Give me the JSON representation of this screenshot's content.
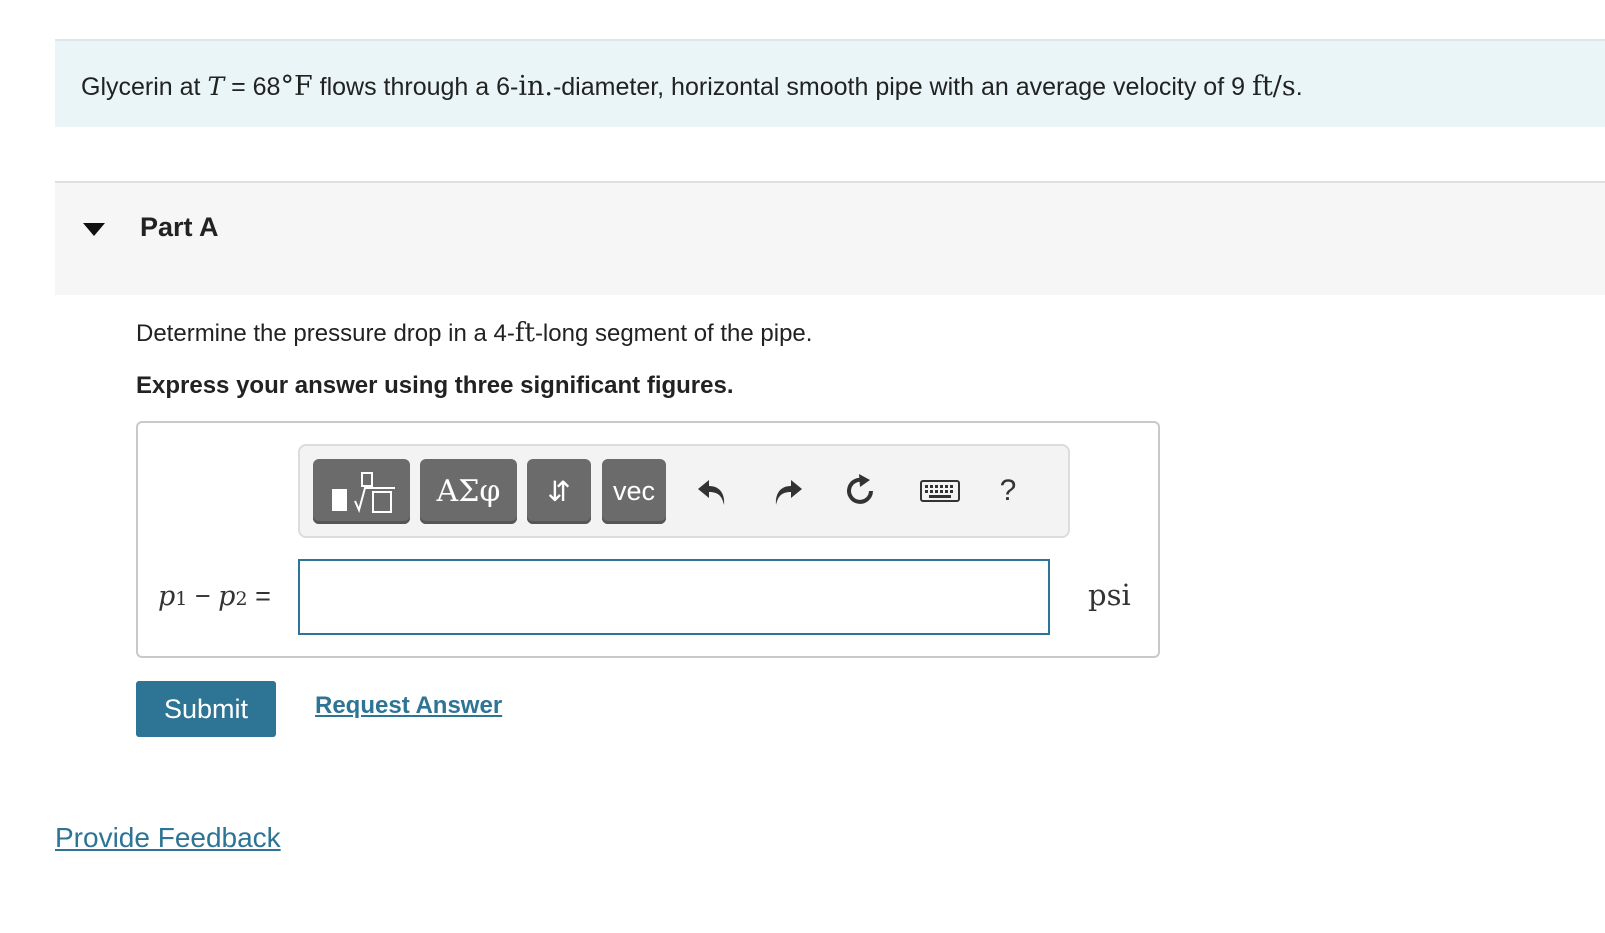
{
  "problem": {
    "text_before": "Glycerin at ",
    "var_T": "T",
    "equals": " = 68",
    "degree": "°",
    "unit_F": "F",
    "text_mid": " flows through a 6-",
    "unit_in": "in.",
    "text_mid2": "-diameter, horizontal smooth pipe with an average velocity of 9 ",
    "unit_velocity": "ft/s",
    "text_end": "."
  },
  "part": {
    "title": "Part A"
  },
  "question": {
    "text_before": "Determine the pressure drop in a 4-",
    "unit_ft": "ft",
    "text_after": "-long segment of the pipe.",
    "instruction": "Express your answer using three significant figures."
  },
  "toolbar": {
    "greek_label": "ΑΣφ",
    "arrows_label": "⇵",
    "vec_label": "vec",
    "help_label": "?"
  },
  "answer": {
    "lhs_p1": "p",
    "lhs_sub1": "1",
    "lhs_minus": " − ",
    "lhs_p2": "p",
    "lhs_sub2": "2",
    "lhs_eq": " =",
    "value": "",
    "units": "psi"
  },
  "actions": {
    "submit_label": "Submit",
    "request_label": "Request Answer"
  },
  "footer": {
    "feedback_label": "Provide Feedback"
  },
  "colors": {
    "accent": "#2e7494",
    "problem_bg": "#e9f5f7",
    "part_bg": "#f6f6f6",
    "toolbar_button": "#6b6b6b"
  }
}
